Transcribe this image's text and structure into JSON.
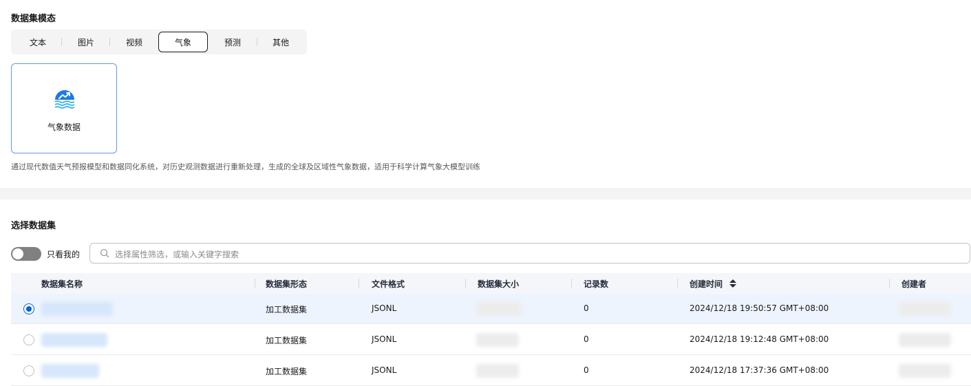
{
  "modality": {
    "title": "数据集模态",
    "tabs": [
      {
        "label": "文本"
      },
      {
        "label": "图片"
      },
      {
        "label": "视频"
      },
      {
        "label": "气象",
        "active": true
      },
      {
        "label": "预测"
      },
      {
        "label": "其他"
      }
    ],
    "card": {
      "label": "气象数据",
      "icon": "weather-chart-icon"
    },
    "description": "通过现代数值天气预报模型和数据同化系统，对历史观测数据进行重新处理，生成的全球及区域性气象数据，适用于科学计算气象大模型训练"
  },
  "dataset": {
    "title": "选择数据集",
    "toggle_label": "只看我的",
    "toggle_on": false,
    "search_placeholder": "选择属性筛选，或输入关键字搜索",
    "columns": [
      "数据集名称",
      "数据集形态",
      "文件格式",
      "数据集大小",
      "记录数",
      "创建时间",
      "创建者"
    ],
    "sort_icon": "sort-updown-icon",
    "rows": [
      {
        "form": "加工数据集",
        "format": "JSONL",
        "records": "0",
        "created": "2024/12/18 19:50:57 GMT+08:00",
        "selected": true
      },
      {
        "form": "加工数据集",
        "format": "JSONL",
        "records": "0",
        "created": "2024/12/18 19:12:48 GMT+08:00",
        "selected": false
      },
      {
        "form": "加工数据集",
        "format": "JSONL",
        "records": "0",
        "created": "2024/12/18 17:37:36 GMT+08:00",
        "selected": false
      }
    ]
  },
  "colors": {
    "accent": "#0062d9",
    "card_border": "#5e98e8",
    "selected_row": "#eef4fd"
  }
}
